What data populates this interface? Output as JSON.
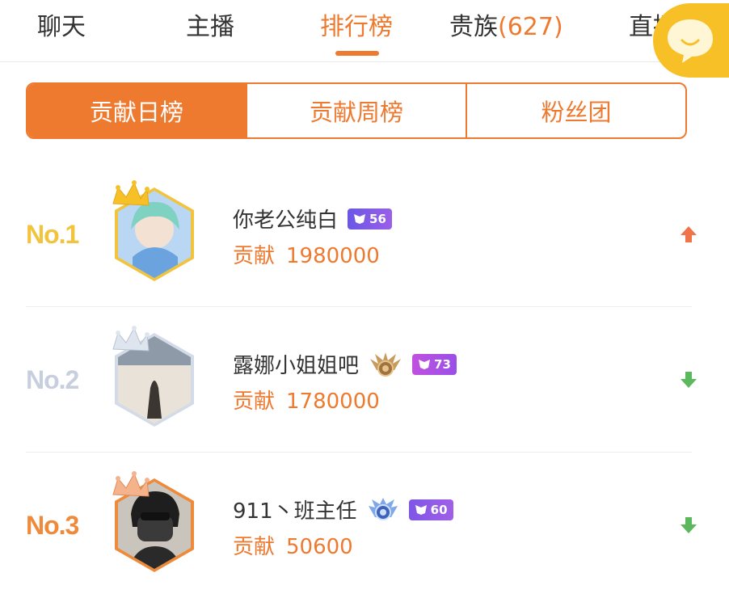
{
  "tabs": [
    {
      "label": "聊天"
    },
    {
      "label": "主播"
    },
    {
      "label": "排行榜"
    },
    {
      "label": "贵族",
      "count": "(627)"
    },
    {
      "label": "直播"
    }
  ],
  "segments": [
    {
      "label": "贡献日榜"
    },
    {
      "label": "贡献周榜"
    },
    {
      "label": "粉丝团"
    }
  ],
  "ranking": {
    "contrib_label": "贡献",
    "rows": [
      {
        "rank": "No.1",
        "name": "你老公纯白",
        "level": "56",
        "value": "1980000",
        "trend": "up"
      },
      {
        "rank": "No.2",
        "name": "露娜小姐姐吧",
        "level": "73",
        "value": "1780000",
        "trend": "down"
      },
      {
        "rank": "No.3",
        "name": "911丶班主任",
        "level": "60",
        "value": "50600",
        "trend": "down"
      }
    ]
  },
  "colors": {
    "accent": "#ee7a30",
    "gold": "#f2c33d",
    "silver": "#c7cfdf",
    "bronze": "#ee8a3a",
    "trend_up": "#f0734a",
    "trend_down": "#5cb85c",
    "level_badge": "#8b57e6"
  },
  "icons": [
    "chat-bubble-icon",
    "crown-icon",
    "trend-up-icon",
    "trend-down-icon",
    "level-badge-icon",
    "rank-medal-icon"
  ]
}
